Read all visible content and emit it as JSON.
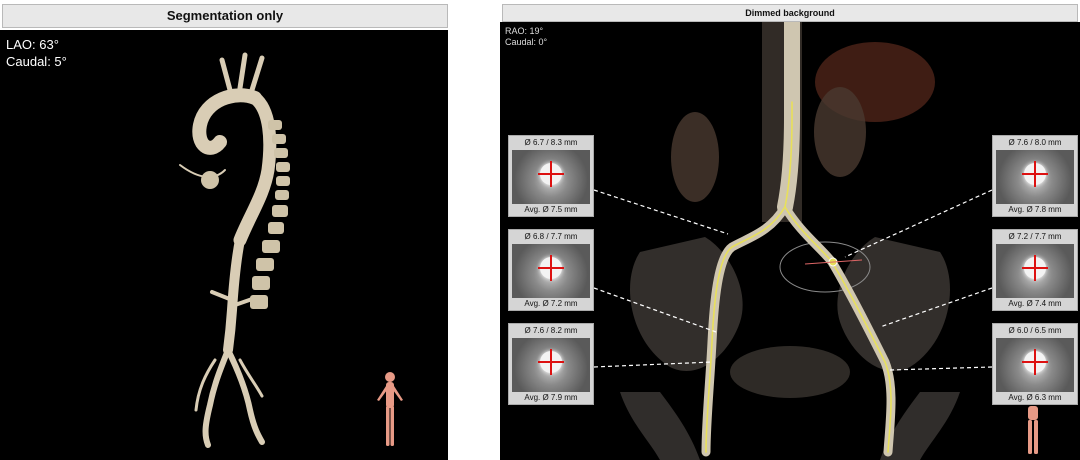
{
  "left_panel": {
    "title": "Segmentation only",
    "view_angle": {
      "line1": "LAO: 63°",
      "line2": "Caudal: 5°"
    }
  },
  "right_panel": {
    "title": "Dimmed background",
    "view_angle": {
      "line1": "RAO: 19°",
      "line2": "Caudal: 0°"
    },
    "cross_sections": [
      {
        "diameter": "Ø 6.7 / 8.3 mm",
        "average": "Avg. Ø 7.5 mm"
      },
      {
        "diameter": "Ø 6.8 / 7.7 mm",
        "average": "Avg. Ø 7.2 mm"
      },
      {
        "diameter": "Ø 7.6 / 8.2 mm",
        "average": "Avg. Ø 7.9 mm"
      },
      {
        "diameter": "Ø 7.6 / 8.0 mm",
        "average": "Avg. Ø 7.8 mm"
      },
      {
        "diameter": "Ø 7.2 / 7.7 mm",
        "average": "Avg. Ø 7.4 mm"
      },
      {
        "diameter": "Ø 6.0 / 6.5 mm",
        "average": "Avg. Ø 6.3 mm"
      }
    ]
  },
  "colors": {
    "vessel": "#d9cdb5",
    "centerline": "#e8e05a",
    "dashed_lines": "#ffffff",
    "orientation_figure": "#e79a86"
  }
}
